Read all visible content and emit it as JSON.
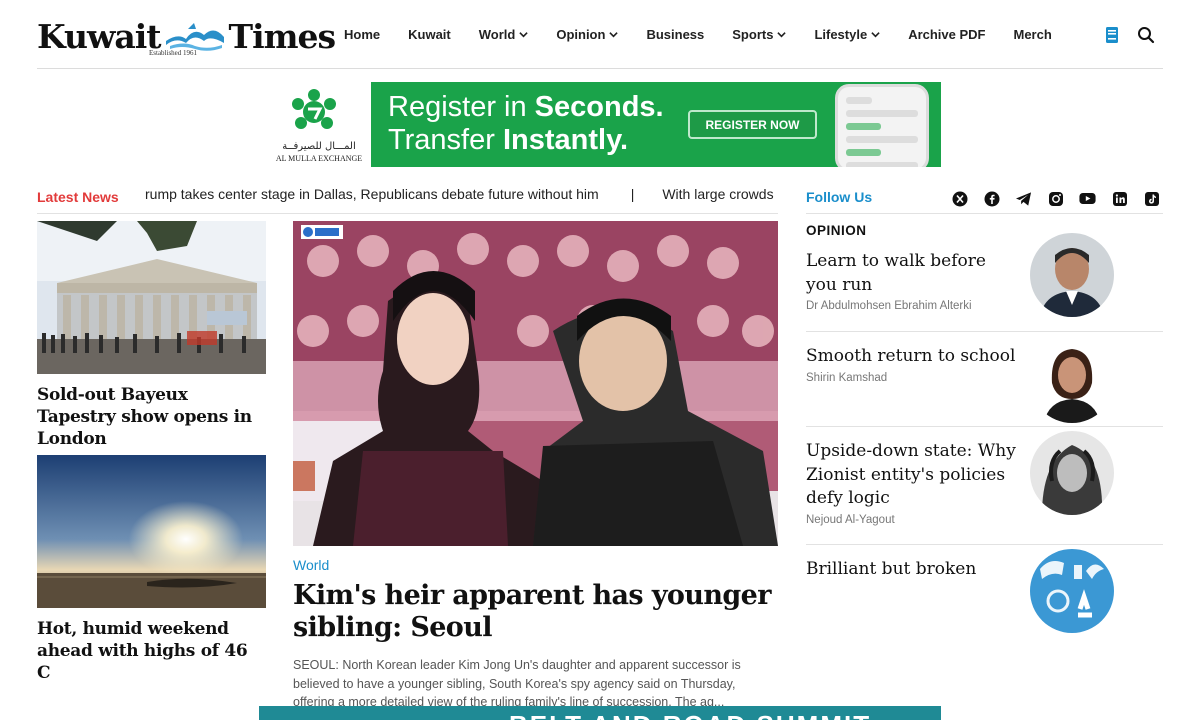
{
  "header": {
    "logo_left": "Kuwait",
    "logo_right": "Times",
    "logo_established": "Established 1961",
    "nav": [
      {
        "label": "Home",
        "dropdown": false
      },
      {
        "label": "Kuwait",
        "dropdown": false
      },
      {
        "label": "World",
        "dropdown": true
      },
      {
        "label": "Opinion",
        "dropdown": true
      },
      {
        "label": "Business",
        "dropdown": false
      },
      {
        "label": "Sports",
        "dropdown": true
      },
      {
        "label": "Lifestyle",
        "dropdown": true
      },
      {
        "label": "Archive PDF",
        "dropdown": false
      },
      {
        "label": "Merch",
        "dropdown": false
      }
    ],
    "icons": [
      "epaper-icon",
      "search-icon"
    ]
  },
  "ad_top": {
    "brand_arabic": "المـــال للصيرفــة",
    "brand_english": "AL MULLA EXCHANGE",
    "line1_regular": "Register in ",
    "line1_bold": "Seconds.",
    "line2_regular": "Transfer ",
    "line2_bold": "Instantly.",
    "button": "REGISTER NOW"
  },
  "ticker": {
    "label": "Latest News",
    "items": [
      "rump takes center stage in Dallas, Republicans debate future without him",
      "With large crowds"
    ],
    "separator": "|"
  },
  "side_stories": [
    {
      "title": "Sold-out Bayeux Tapestry show opens in London"
    },
    {
      "title": "Hot, humid weekend ahead with highs of 46 C"
    }
  ],
  "main_story": {
    "category": "World",
    "title": "Kim's heir apparent has younger sibling: Seoul",
    "summary": "SEOUL: North Korean leader Kim Jong Un's daughter and apparent successor is believed to have a younger sibling, South Korea's spy agency said on Thursday, offering a more detailed view of the ruling family's line of succession. The ag..."
  },
  "follow": {
    "label": "Follow Us",
    "icons": [
      "x-icon",
      "facebook-icon",
      "telegram-icon",
      "instagram-icon",
      "youtube-icon",
      "linkedin-icon",
      "tiktok-icon"
    ]
  },
  "opinion": {
    "heading": "OPINION",
    "items": [
      {
        "title": "Learn to walk before you run",
        "author": "Dr Abdulmohsen Ebrahim Alterki"
      },
      {
        "title": "Smooth return to school",
        "author": "Shirin Kamshad"
      },
      {
        "title": "Upside-down state: Why Zionist entity's policies defy logic",
        "author": "Nejoud Al-Yagout"
      },
      {
        "title": "Brilliant but broken",
        "author": ""
      }
    ]
  },
  "ad_bottom": {
    "text": "BELT AND ROAD SUMMIT"
  },
  "colors": {
    "accent_red": "#e23b3b",
    "accent_blue": "#1a8ecb",
    "ad_green": "#1aa34a"
  }
}
